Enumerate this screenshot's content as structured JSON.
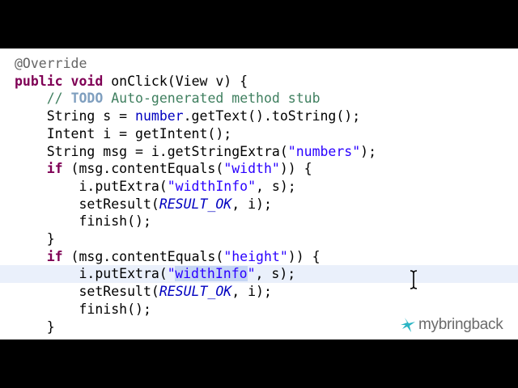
{
  "editor": {
    "current_line_index": 12,
    "selected_text": "widthInfo",
    "lines": [
      {
        "tokens": [
          {
            "t": "ann",
            "v": "@Override"
          }
        ]
      },
      {
        "tokens": [
          {
            "t": "kw",
            "v": "public"
          },
          {
            "t": "plain",
            "v": " "
          },
          {
            "t": "kw",
            "v": "void"
          },
          {
            "t": "plain",
            "v": " onClick(View v) {"
          }
        ]
      },
      {
        "tokens": [
          {
            "t": "plain",
            "v": "    "
          },
          {
            "t": "cm",
            "v": "// "
          },
          {
            "t": "todo",
            "v": "TODO"
          },
          {
            "t": "cm",
            "v": " Auto-generated method stub"
          }
        ]
      },
      {
        "tokens": [
          {
            "t": "plain",
            "v": "    String s = "
          },
          {
            "t": "fld",
            "v": "number"
          },
          {
            "t": "plain",
            "v": ".getText().toString();"
          }
        ]
      },
      {
        "tokens": [
          {
            "t": "plain",
            "v": "    Intent i = getIntent();"
          }
        ]
      },
      {
        "tokens": [
          {
            "t": "plain",
            "v": "    String msg = i.getStringExtra("
          },
          {
            "t": "str",
            "v": "\"numbers\""
          },
          {
            "t": "plain",
            "v": ");"
          }
        ]
      },
      {
        "tokens": [
          {
            "t": "plain",
            "v": "    "
          },
          {
            "t": "kw",
            "v": "if"
          },
          {
            "t": "plain",
            "v": " (msg.contentEquals("
          },
          {
            "t": "str",
            "v": "\"width\""
          },
          {
            "t": "plain",
            "v": ")) {"
          }
        ]
      },
      {
        "tokens": [
          {
            "t": "plain",
            "v": "        i.putExtra("
          },
          {
            "t": "str",
            "v": "\"widthInfo\""
          },
          {
            "t": "plain",
            "v": ", s);"
          }
        ]
      },
      {
        "tokens": [
          {
            "t": "plain",
            "v": "        setResult("
          },
          {
            "t": "const",
            "v": "RESULT_OK"
          },
          {
            "t": "plain",
            "v": ", i);"
          }
        ]
      },
      {
        "tokens": [
          {
            "t": "plain",
            "v": "        finish();"
          }
        ]
      },
      {
        "tokens": [
          {
            "t": "plain",
            "v": "    }"
          }
        ]
      },
      {
        "tokens": [
          {
            "t": "plain",
            "v": "    "
          },
          {
            "t": "kw",
            "v": "if"
          },
          {
            "t": "plain",
            "v": " (msg.contentEquals("
          },
          {
            "t": "str",
            "v": "\"height\""
          },
          {
            "t": "plain",
            "v": ")) {"
          }
        ]
      },
      {
        "tokens": [
          {
            "t": "plain",
            "v": "        i.putExtra("
          },
          {
            "t": "str",
            "v": "\""
          },
          {
            "t": "caret",
            "v": ""
          },
          {
            "t": "strsel",
            "v": "widthInfo"
          },
          {
            "t": "str",
            "v": "\""
          },
          {
            "t": "plain",
            "v": ", s);"
          }
        ]
      },
      {
        "tokens": [
          {
            "t": "plain",
            "v": "        setResult("
          },
          {
            "t": "const",
            "v": "RESULT_OK"
          },
          {
            "t": "plain",
            "v": ", i);"
          }
        ]
      },
      {
        "tokens": [
          {
            "t": "plain",
            "v": "        finish();"
          }
        ]
      },
      {
        "tokens": [
          {
            "t": "plain",
            "v": "    }"
          }
        ]
      }
    ]
  },
  "logo": {
    "text": "mybringback",
    "mark_color": "#2bb5c4"
  },
  "colors": {
    "keyword": "#7f0055",
    "string": "#2a00ff",
    "comment": "#3f7f5f",
    "field": "#0000c0",
    "current_line": "#eaf0fb",
    "selection": "#c5d5f4"
  }
}
